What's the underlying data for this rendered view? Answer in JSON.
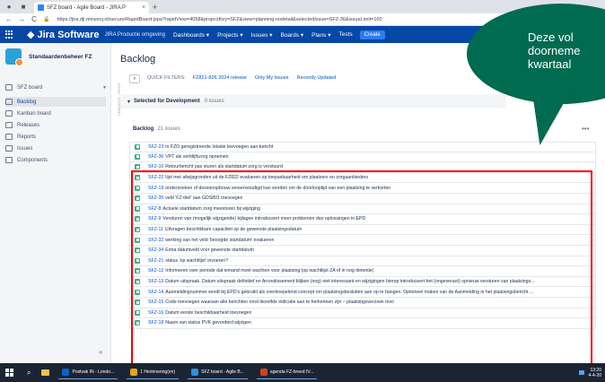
{
  "browser": {
    "tab_title": "SFZ board - Agile Board - JIRA P",
    "tab_close": "×",
    "new_tab": "+",
    "url": "https://jira.dji.minvenj.nl/secure/RapidBoard.jspa?rapidView=4058&projectKey=SFZ&view=planning.nodetail&selectedIssue=SFZ-36&issueLimit=100",
    "back": "←",
    "forward": "→",
    "reload": "C"
  },
  "topnav": {
    "product": "Jira Software",
    "env": "JIRA Productie omgeving",
    "items": [
      "Dashboards ▾",
      "Projects ▾",
      "Issues ▾",
      "Boards ▾",
      "Plans ▾",
      "Tests"
    ],
    "create": "Create"
  },
  "sidebar": {
    "project": "Standaardenbeheer FZ",
    "items": [
      {
        "label": "SFZ board",
        "caret": "▾"
      },
      {
        "label": "Backlog"
      },
      {
        "label": "Kanban board"
      },
      {
        "label": "Releases"
      },
      {
        "label": "Reports"
      },
      {
        "label": "Issues"
      },
      {
        "label": "Components"
      }
    ],
    "collapse": "«"
  },
  "main": {
    "title": "Backlog",
    "search_icon": "⌕",
    "filters_label": "QUICK FILTERS:",
    "filters": [
      "FZ821-826 2024 release",
      "Only My Issues",
      "Recently Updated"
    ],
    "vertical_strip": "VERSIONS · EPICS",
    "selected": {
      "chevron": "▾",
      "title": "Selected for Development",
      "count": "0 issues"
    },
    "backlog": {
      "title": "Backlog",
      "count": "21 issues",
      "more": "•••"
    }
  },
  "issues": [
    {
      "key": "SFZ-23",
      "summary": "in FZO geregistreerde lokatie toevoegen aan bericht"
    },
    {
      "key": "SFZ-36",
      "summary": "VPT als verblijfszorg opnemen"
    },
    {
      "key": "SFZ-10",
      "summary": "Retourbericht pas sturen als startdatum zorg is verstuurd"
    },
    {
      "key": "SFZ-22",
      "summary": "lijst met afwijsgronden uit de FZ822 evalueren op toepasbaarheid om plaatsers en zorgaanbieders"
    },
    {
      "key": "SFZ-19",
      "summary": "onderzoeken of dossieropbouw vereenvoudigd kan worden om de doorlooptijd van een plaatsing te verkorten"
    },
    {
      "key": "SFZ-35",
      "summary": "veld 'FZ-titel' aan GDS801 toevoegen"
    },
    {
      "key": "SFZ-8",
      "summary": "Actuele startdatum zorg meesturen bij wijziging"
    },
    {
      "key": "SFZ-9",
      "summary": "Versturen van (mogelijk wijzigende) bijlagen introduceert meer problemen dan oplossingen in EPD"
    },
    {
      "key": "SFZ-11",
      "summary": "Uitvragen beschikbare capaciteit op de gewenste plaatsingsdatum"
    },
    {
      "key": "SFZ-32",
      "summary": "werking van het veld 'beoogde startdatum' evalueren"
    },
    {
      "key": "SFZ-34",
      "summary": "Extra datumveld voor gewenste startdatum"
    },
    {
      "key": "SFZ-21",
      "summary": "status 'op wachtlijst' invoeren?"
    },
    {
      "key": "SFZ-12",
      "summary": "Informeren over periode dat iemand moet wachten voor plaatsing (op wachtlijst ZA of in nog detentie)"
    },
    {
      "key": "SFZ-13",
      "summary": "Datum uitspraak. Datum uitspraak definitief en Arrondissement blijken (nog) niet interessant en wijzigingen hierop introduceert het (ongeveraot) opnieuw versturen van plaatsings..."
    },
    {
      "key": "SFZ-14",
      "summary": "Aanmeldingnummer wordt bij EPD's gebruikt als overkoepelend concept om plaatsingsbesluiten aan op te hangen. Optioneel maken van de Aanmelding in het plaatsingsbericht ..."
    },
    {
      "key": "SFZ-15",
      "summary": "Code toevoegen waaraan alle berichten rond dezelfde indicatie aan te herkennen zijn – plaatsingsverzoek mvo"
    },
    {
      "key": "SFZ-16",
      "summary": "Datum eerste beschikbaarheid toevoegen"
    },
    {
      "key": "SFZ-18",
      "summary": "Naam van status PVK gevorderd wijzigen"
    }
  ],
  "callout": {
    "text": "Deze vol\ndoorneme\nkwartaal",
    "color": "#006b4f"
  },
  "taskbar": {
    "apps": [
      "Postvak IN - Londo...",
      "1 Herinnering(en)",
      "SFZ board - Agile B...",
      "agenda FZ-breed IV..."
    ],
    "clock_time": "13:20",
    "clock_date": "4-4-20"
  },
  "colors": {
    "jira_blue": "#0747a6",
    "highlight": "#ff0000",
    "story_green": "#36b37e"
  }
}
